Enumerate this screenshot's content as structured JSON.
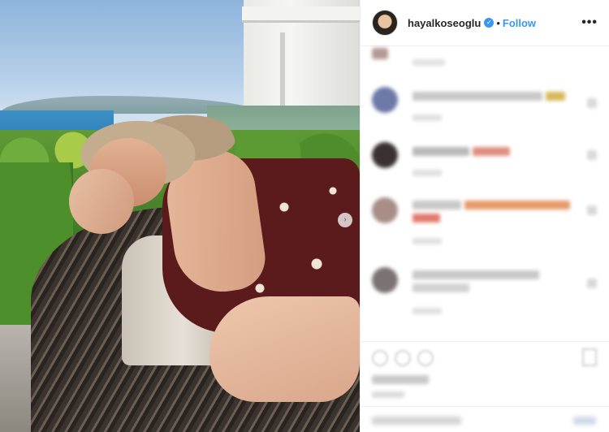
{
  "header": {
    "username": "hayalkoseoglu",
    "verified_icon": "verified-badge-icon",
    "separator": "•",
    "follow_label": "Follow",
    "more_icon": "•••"
  },
  "photo": {
    "carousel_indicator": "›"
  },
  "colors": {
    "accent": "#3897f0",
    "text": "#262626",
    "divider": "#efefef"
  }
}
